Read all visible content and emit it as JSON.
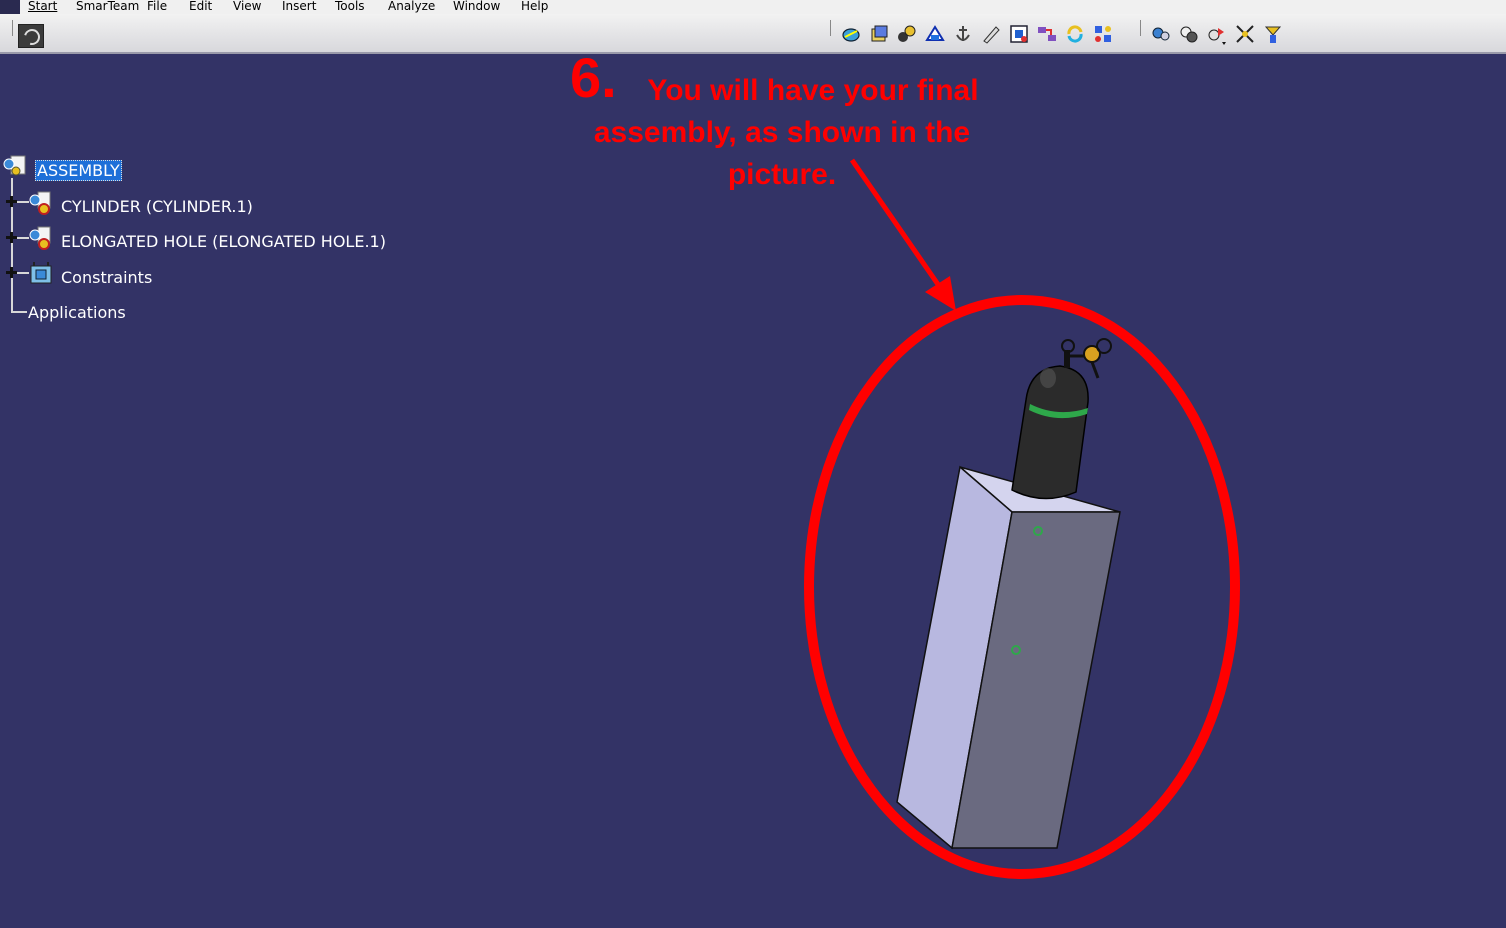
{
  "menu": {
    "items": [
      "Start",
      "SmarTeam",
      "File",
      "Edit",
      "View",
      "Insert",
      "Tools",
      "Analyze",
      "Window",
      "Help"
    ]
  },
  "toolbar": {
    "icons": [
      "knowledge-icon",
      "product-icon",
      "component-icon",
      "existing-component-icon",
      "anchor-icon",
      "pencil-icon",
      "manipulate-icon",
      "snap-icon",
      "update-icon",
      "constraint-icon",
      "fix-icon",
      "contact-icon",
      "offset-icon",
      "angle-icon",
      "reuse-pattern-icon"
    ]
  },
  "tree": {
    "root": "ASSEMBLY",
    "children": [
      {
        "label": "CYLINDER (CYLINDER.1)"
      },
      {
        "label": "ELONGATED HOLE (ELONGATED HOLE.1)"
      },
      {
        "label": "Constraints"
      }
    ],
    "applications": "Applications"
  },
  "annotation": {
    "number": "6.",
    "text": "You will have your final assembly, as shown in the picture.",
    "color": "#ff0000"
  },
  "colors": {
    "background": "#333366",
    "selection": "#1d6fd8",
    "box_light": "#b8b8e0",
    "box_dark": "#6a6a80",
    "cylinder": "#2b2b2b",
    "band": "#2ea84a"
  }
}
